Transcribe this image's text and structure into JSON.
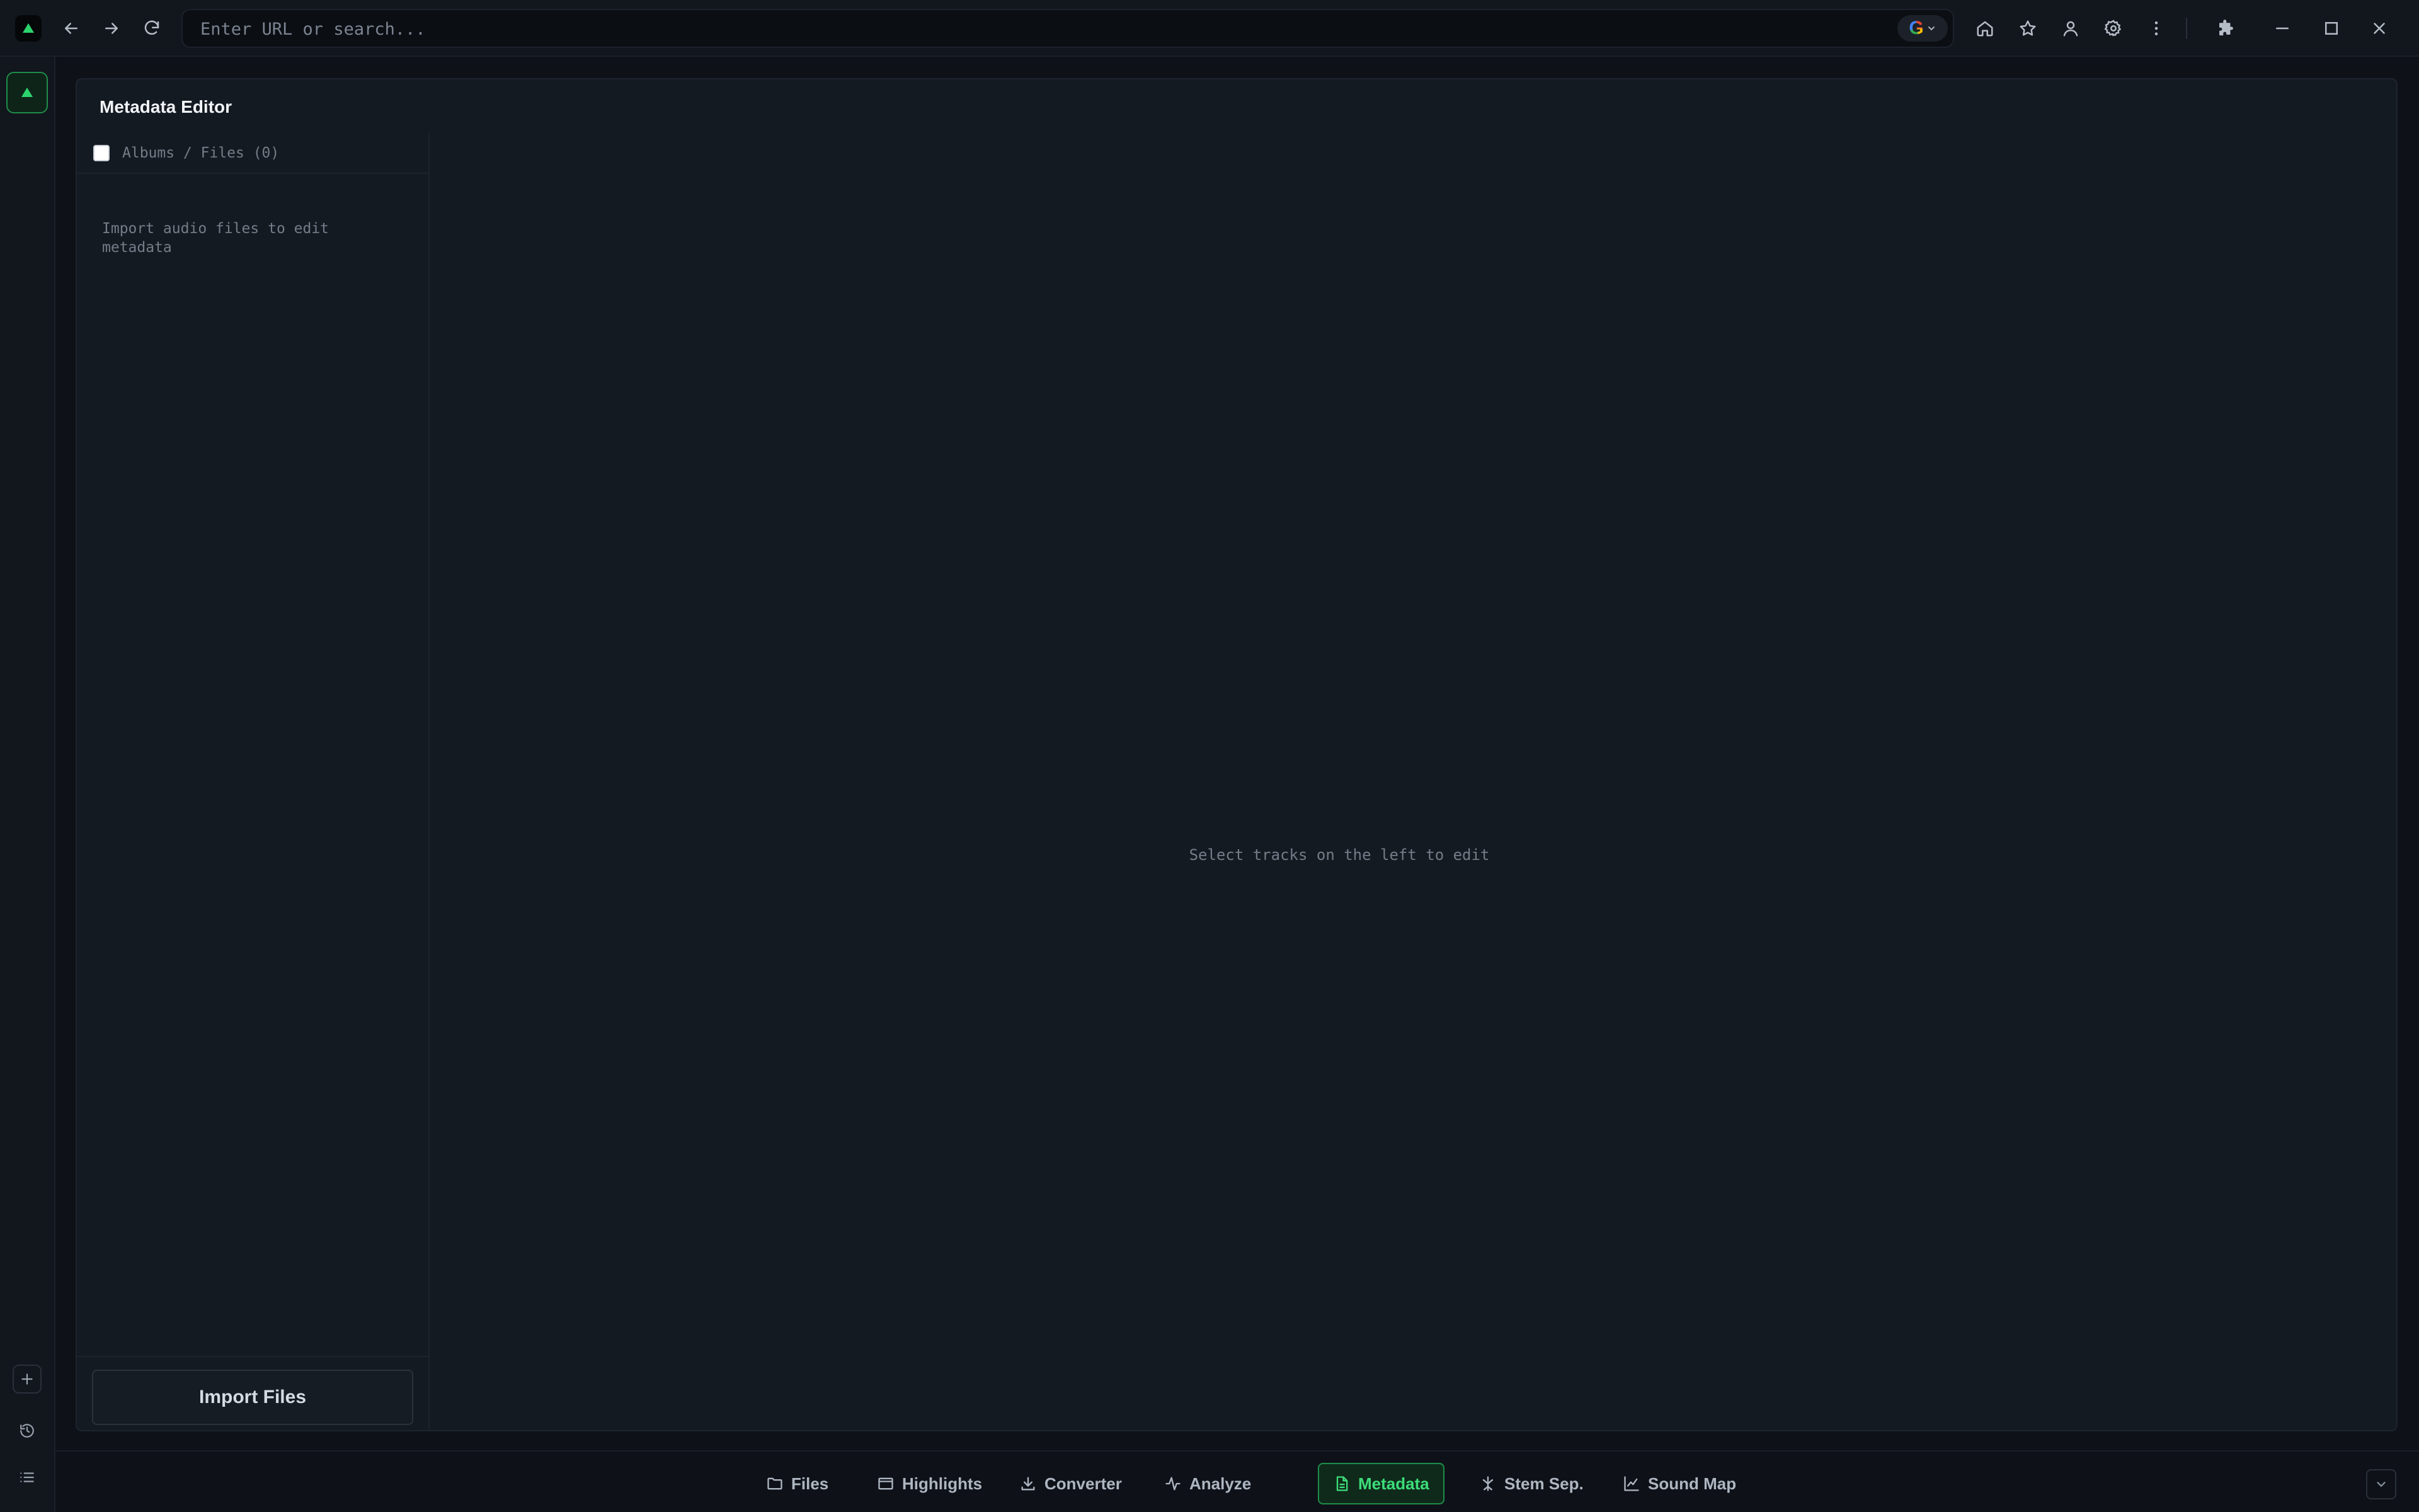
{
  "browser": {
    "url_placeholder": "Enter URL or search...",
    "url_value": "",
    "search_engine": "G"
  },
  "panel": {
    "title": "Metadata Editor",
    "file_list": {
      "header_label": "Albums / Files (0)",
      "empty_message": "Import audio files to edit metadata",
      "import_button": "Import Files"
    },
    "editor": {
      "empty_message": "Select tracks on the left to edit"
    }
  },
  "bottom_tabs": [
    {
      "label": "Files",
      "icon": "folder-icon"
    },
    {
      "label": "Highlights",
      "icon": "highlights-icon"
    },
    {
      "label": "Converter",
      "icon": "download-icon"
    },
    {
      "label": "Analyze",
      "icon": "activity-icon"
    },
    {
      "label": "Metadata",
      "icon": "document-icon",
      "active": true
    },
    {
      "label": "Stem Sep.",
      "icon": "split-icon"
    },
    {
      "label": "Sound Map",
      "icon": "chart-icon"
    }
  ],
  "colors": {
    "accent": "#3ddc7a",
    "accent_border": "#1f8d49",
    "background": "#0e1218",
    "panel": "#141a22"
  }
}
